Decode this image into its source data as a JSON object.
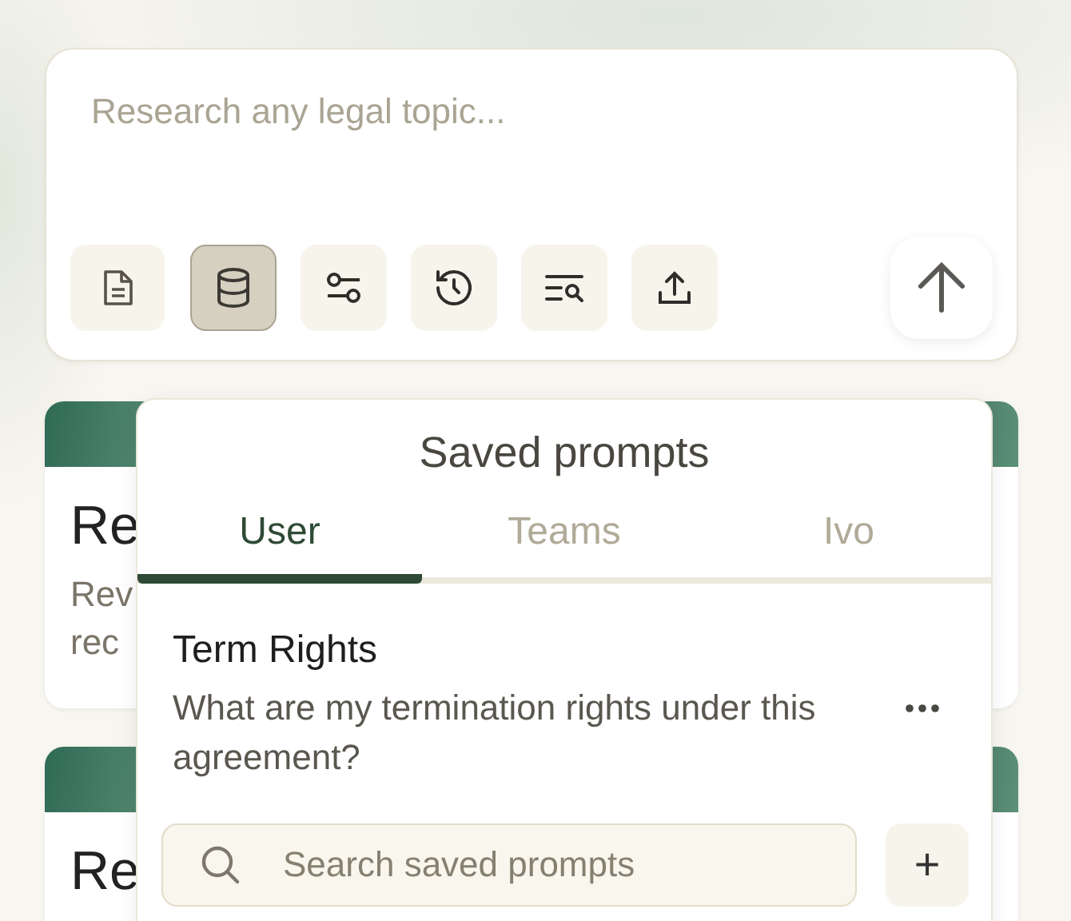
{
  "composer": {
    "placeholder": "Research any legal topic...",
    "tools": [
      {
        "kind": "document",
        "selected": false
      },
      {
        "kind": "database",
        "selected": true
      },
      {
        "kind": "sliders",
        "selected": false
      },
      {
        "kind": "history",
        "selected": false
      },
      {
        "kind": "list-search",
        "selected": false
      },
      {
        "kind": "upload",
        "selected": false
      }
    ]
  },
  "cards": [
    {
      "title": "Re",
      "lines": [
        "Rev",
        "rec"
      ]
    },
    {
      "title": "Re"
    }
  ],
  "saved_prompts": {
    "title": "Saved prompts",
    "tabs": [
      {
        "label": "User",
        "selected": true
      },
      {
        "label": "Teams",
        "selected": false
      },
      {
        "label": "Ivo",
        "selected": false
      }
    ],
    "items": [
      {
        "name": "Term Rights",
        "text": "What are my termination rights under this agreement?"
      }
    ],
    "search": {
      "placeholder": "Search saved prompts"
    },
    "add_label": "+"
  }
}
